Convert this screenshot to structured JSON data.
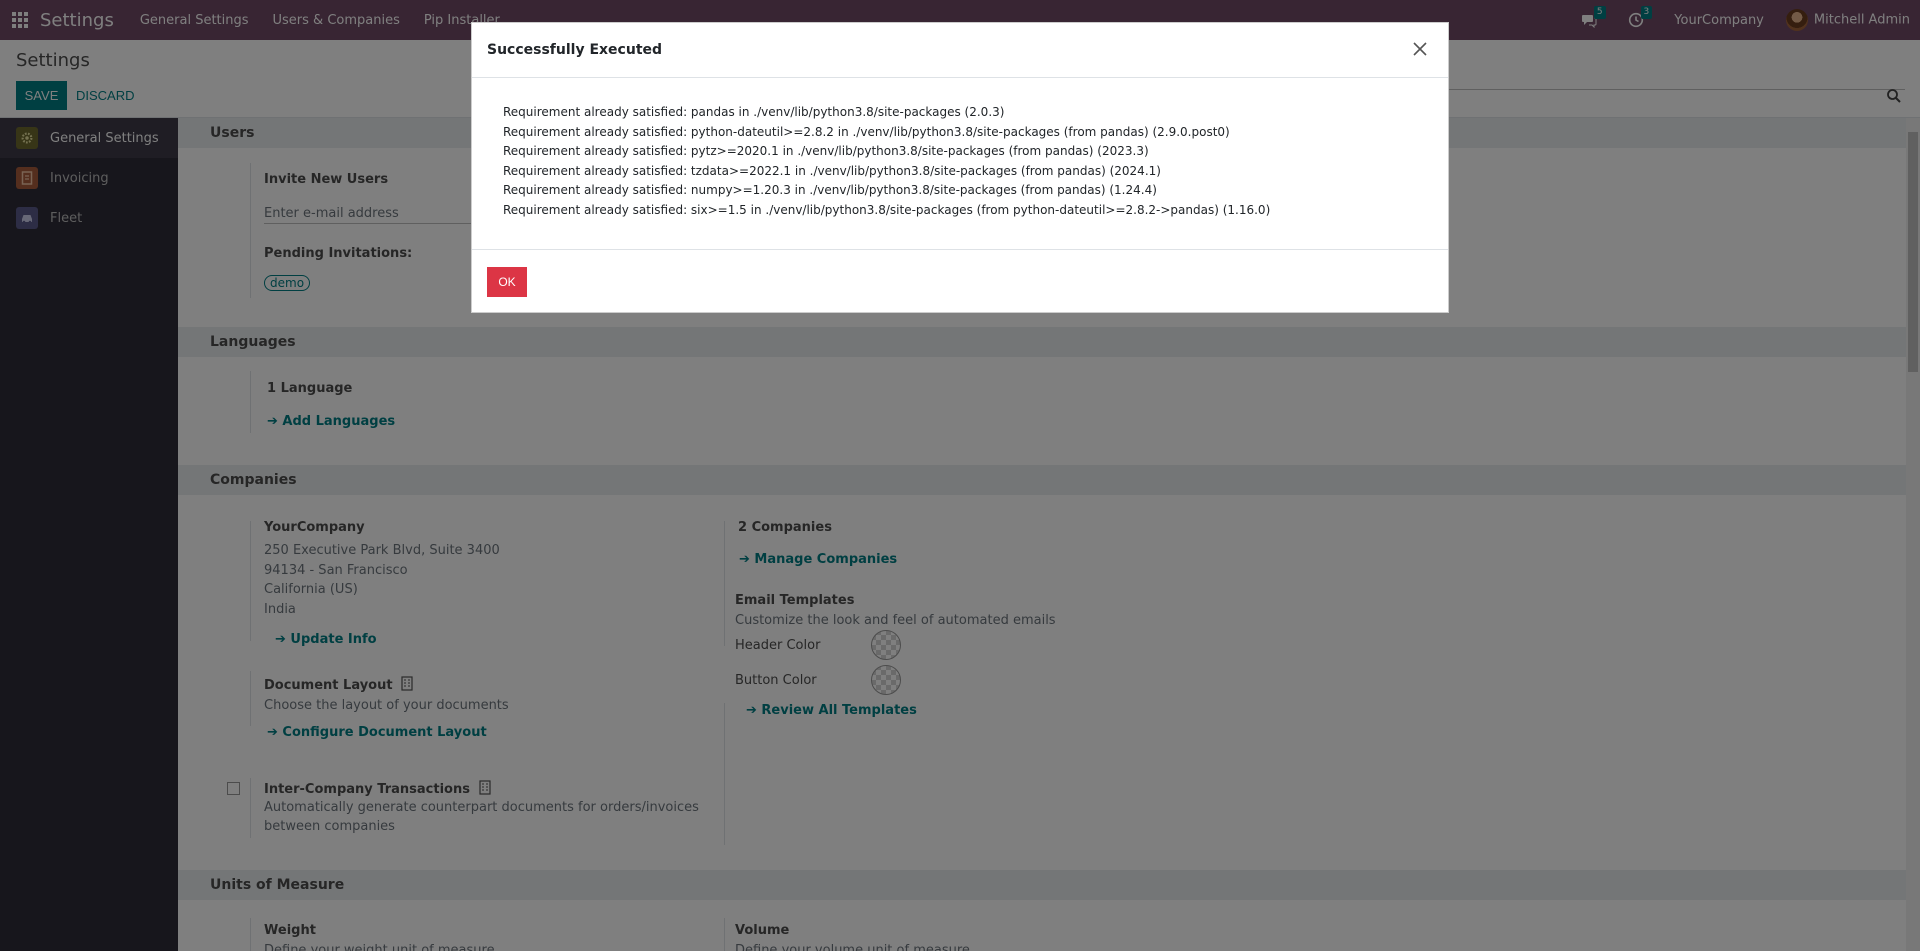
{
  "navbar": {
    "app_title": "Settings",
    "menu": [
      "General Settings",
      "Users & Companies",
      "Pip Installer"
    ],
    "messages_count": "5",
    "activities_count": "3",
    "company": "YourCompany",
    "user": "Mitchell Admin"
  },
  "control": {
    "title": "Settings",
    "save_label": "SAVE",
    "discard_label": "DISCARD"
  },
  "sidebar": {
    "items": [
      {
        "label": "General Settings",
        "icon": "gear-icon",
        "color": "#6f6b2f"
      },
      {
        "label": "Invoicing",
        "icon": "invoice-icon",
        "color": "#a85c3c"
      },
      {
        "label": "Fleet",
        "icon": "car-icon",
        "color": "#5a5b8a"
      }
    ]
  },
  "users": {
    "heading": "Users",
    "invite_label": "Invite New Users",
    "email_placeholder": "Enter e-mail address",
    "pending_label": "Pending Invitations:",
    "pending_tag": "demo"
  },
  "languages": {
    "heading": "Languages",
    "count": "1 Language",
    "add_link": "Add Languages"
  },
  "companies": {
    "heading": "Companies",
    "company_name": "YourCompany",
    "address_lines": [
      "250 Executive Park Blvd, Suite 3400",
      "94134 - San Francisco",
      "California (US)",
      "India"
    ],
    "update_link": "Update Info",
    "count": "2 Companies",
    "manage_link": "Manage Companies",
    "email_templates_title": "Email Templates",
    "email_templates_desc": "Customize the look and feel of automated emails",
    "header_color_label": "Header Color",
    "button_color_label": "Button Color",
    "review_link": "Review All Templates",
    "doc_layout_title": "Document Layout",
    "doc_layout_desc": "Choose the layout of your documents",
    "configure_link": "Configure Document Layout",
    "interco_title": "Inter-Company Transactions",
    "interco_desc_1": "Automatically generate counterpart documents for orders/invoices",
    "interco_desc_2": "between companies"
  },
  "uom": {
    "heading": "Units of Measure",
    "weight_title": "Weight",
    "weight_desc": "Define your weight unit of measure",
    "volume_title": "Volume",
    "volume_desc": "Define your volume unit of measure"
  },
  "modal": {
    "title": "Successfully Executed",
    "lines": [
      "Requirement already satisfied: pandas in ./venv/lib/python3.8/site-packages (2.0.3)",
      "Requirement already satisfied: python-dateutil>=2.8.2 in ./venv/lib/python3.8/site-packages (from pandas) (2.9.0.post0)",
      "Requirement already satisfied: pytz>=2020.1 in ./venv/lib/python3.8/site-packages (from pandas) (2023.3)",
      "Requirement already satisfied: tzdata>=2022.1 in ./venv/lib/python3.8/site-packages (from pandas) (2024.1)",
      "Requirement already satisfied: numpy>=1.20.3 in ./venv/lib/python3.8/site-packages (from pandas) (1.24.4)",
      "Requirement already satisfied: six>=1.5 in ./venv/lib/python3.8/site-packages (from python-dateutil>=2.8.2->pandas) (1.16.0)"
    ],
    "ok_label": "OK"
  }
}
